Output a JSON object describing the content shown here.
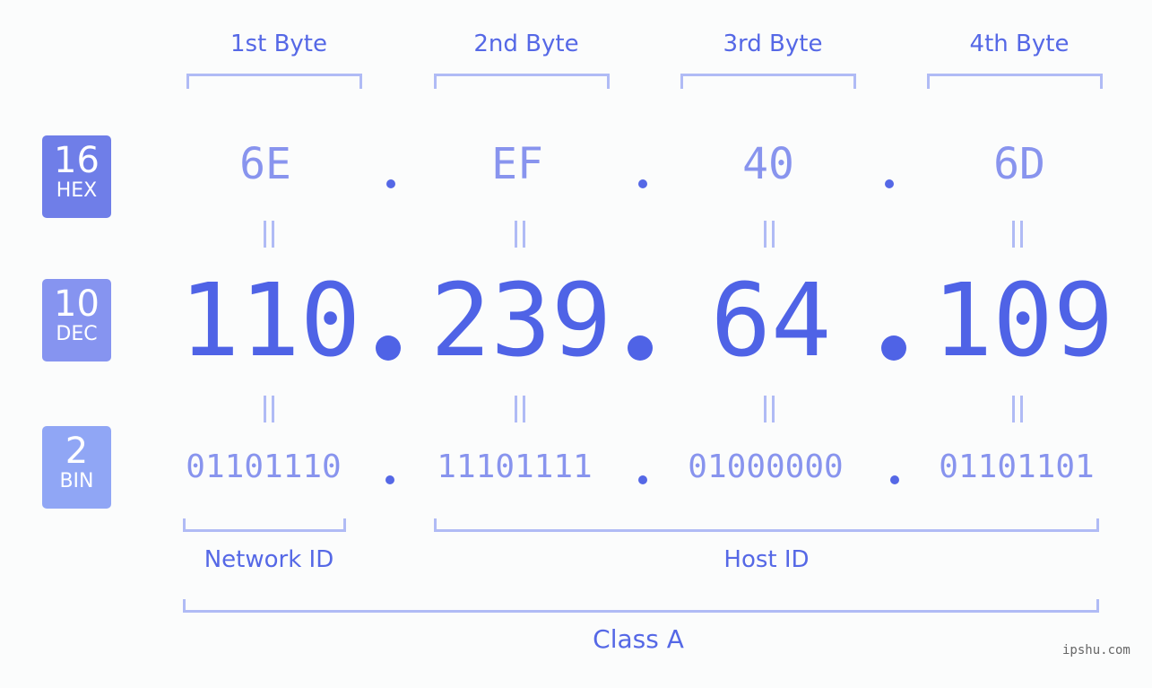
{
  "headers": [
    "1st Byte",
    "2nd Byte",
    "3rd Byte",
    "4th Byte"
  ],
  "badges": {
    "hex": {
      "num": "16",
      "label": "HEX",
      "color": "#6f7ee8"
    },
    "dec": {
      "num": "10",
      "label": "DEC",
      "color": "#8694f0"
    },
    "bin": {
      "num": "2",
      "label": "BIN",
      "color": "#90a6f5"
    }
  },
  "hex": [
    "6E",
    "EF",
    "40",
    "6D"
  ],
  "dec": [
    "110",
    "239",
    "64",
    "109"
  ],
  "bin": [
    "01101110",
    "11101111",
    "01000000",
    "01101101"
  ],
  "separator": ".",
  "network_label": "Network ID",
  "host_label": "Host ID",
  "class_label": "Class A",
  "watermark": "ipshu.com"
}
